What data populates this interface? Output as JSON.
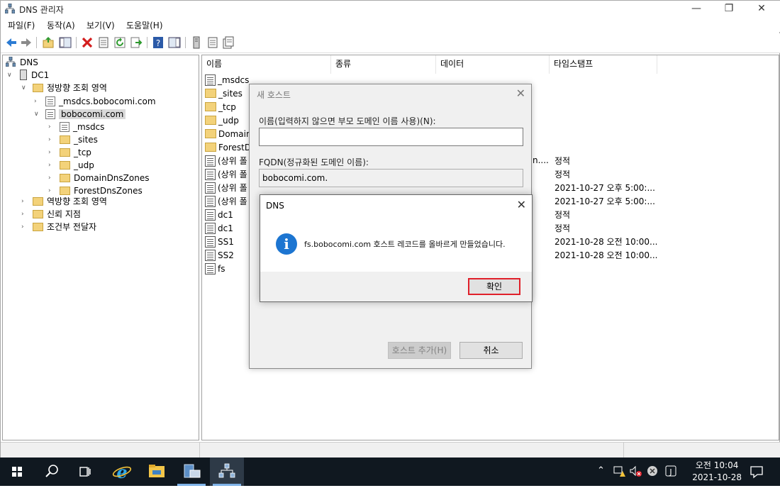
{
  "window": {
    "title": "DNS 관리자",
    "min_icon": "minimize-icon",
    "restore_icon": "restore-icon",
    "close_icon": "close-icon"
  },
  "menu": [
    "파일(F)",
    "동작(A)",
    "보기(V)",
    "도움말(H)"
  ],
  "toolbar": [
    "back-icon",
    "forward-icon",
    "up-folder-icon",
    "show-hide-tree-icon",
    "delete-icon",
    "properties-icon",
    "refresh-icon",
    "export-icon",
    "help-icon",
    "action-pane-icon",
    "server-icon",
    "new-host-icon",
    "new-record-icon"
  ],
  "tree": {
    "root": "DNS",
    "server": "DC1",
    "forward_zone": "정방향 조회 영역",
    "zone_msdcs": "_msdcs.bobocomi.com",
    "zone_main": "bobocomi.com",
    "children": [
      "_msdcs",
      "_sites",
      "_tcp",
      "_udp",
      "DomainDnsZones",
      "ForestDnsZones"
    ],
    "reverse_zone": "역방향 조회 영역",
    "trust_points": "신뢰 지점",
    "conditional_forwarders": "조건부 전달자"
  },
  "list": {
    "columns": [
      "이름",
      "종류",
      "데이터",
      "타임스탬프"
    ],
    "rows": [
      {
        "name": "_msdcs",
        "kind": "zone",
        "timestamp": ""
      },
      {
        "name": "_sites",
        "kind": "folder",
        "timestamp": ""
      },
      {
        "name": "_tcp",
        "kind": "folder",
        "timestamp": ""
      },
      {
        "name": "_udp",
        "kind": "folder",
        "timestamp": ""
      },
      {
        "name": "Domain",
        "kind": "folder",
        "timestamp": ""
      },
      {
        "name": "ForestDr",
        "kind": "folder",
        "timestamp": ""
      },
      {
        "name": "(상위 폴",
        "kind": "record",
        "timestamp": "정적"
      },
      {
        "name": "(상위 폴",
        "kind": "record",
        "timestamp": "정적"
      },
      {
        "name": "(상위 폴",
        "kind": "record",
        "timestamp": "2021-10-27 오후 5:00:..."
      },
      {
        "name": "(상위 폴",
        "kind": "record",
        "timestamp": "2021-10-27 오후 5:00:..."
      },
      {
        "name": "dc1",
        "kind": "record",
        "timestamp": "정적"
      },
      {
        "name": "dc1",
        "kind": "record",
        "timestamp": "정적"
      },
      {
        "name": "SS1",
        "kind": "record",
        "timestamp": "2021-10-28 오전 10:00..."
      },
      {
        "name": "SS2",
        "kind": "record",
        "timestamp": "2021-10-28 오전 10:00..."
      },
      {
        "name": "fs",
        "kind": "record",
        "timestamp": ""
      }
    ],
    "data_fragment": "n...."
  },
  "new_host_dialog": {
    "title": "새 호스트",
    "name_label": "이름(입력하지 않으면 부모 도메인 이름 사용)(N):",
    "name_value": "",
    "fqdn_label": "FQDN(정규화된 도메인 이름):",
    "fqdn_value": "bobocomi.com.",
    "add_host_button": "호스트 추가(H)",
    "cancel_button": "취소"
  },
  "message_box": {
    "title": "DNS",
    "message": "fs.bobocomi.com 호스트 레코드를 올바르게 만들었습니다.",
    "ok_button": "확인",
    "icon": "info-icon"
  },
  "taskbar": {
    "apps": [
      "start-icon",
      "search-icon",
      "task-view-icon",
      "internet-explorer-icon",
      "file-explorer-icon",
      "server-manager-icon",
      "dns-manager-icon"
    ],
    "time": "오전 10:04",
    "date": "2021-10-28",
    "tray": [
      "chevron-up-icon",
      "network-warning-icon",
      "volume-muted-icon",
      "error-icon",
      "ime-icon",
      "notification-icon"
    ]
  },
  "colors": {
    "accent": "#1c75d1",
    "highlight_border": "#e0202a",
    "folder": "#f3d27a",
    "taskbar": "#101820"
  }
}
